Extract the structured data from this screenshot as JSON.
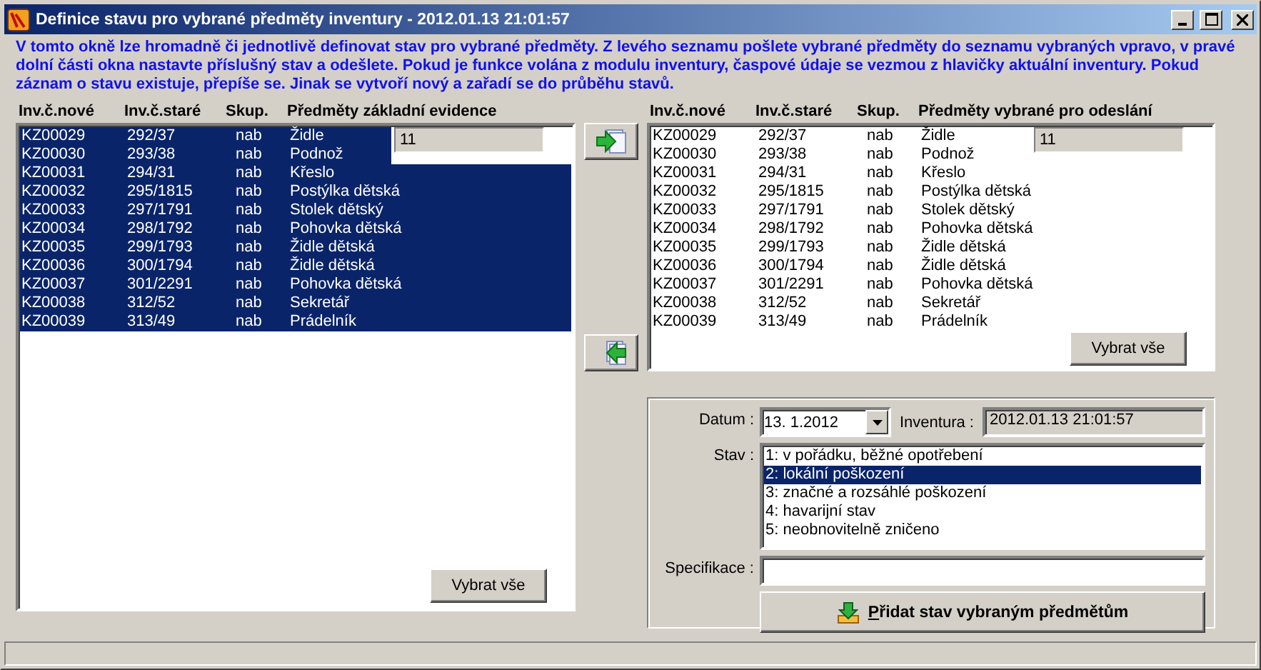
{
  "window": {
    "title": "Definice stavu pro vybrané předměty inventury - 2012.01.13 21:01:57"
  },
  "info": "V tomto okně lze hromadně či jednotlivě definovat stav pro vybrané předměty. Z levého seznamu pošlete vybrané předměty do seznamu vybraných vpravo, v pravé dolní části okna  nastavte příslušný stav a odešlete. Pokud  je funkce volána z modulu inventury, časpové údaje se vezmou z hlavičky aktuální inventury. Pokud záznam o stavu existuje, přepíše se. Jinak se vytvoří nový a zařadí se do průběhu stavů.",
  "left_list": {
    "columns": [
      "Inv.č.nové",
      "Inv.č.staré",
      "Skup.",
      "Předměty základní evidence"
    ],
    "count": "11",
    "button": "Vybrat vše",
    "rows": [
      {
        "cells": [
          "KZ00029",
          "292/37",
          "nab",
          "Židle"
        ],
        "selected": true
      },
      {
        "cells": [
          "KZ00030",
          "293/38",
          "nab",
          "Podnož"
        ],
        "selected": true
      },
      {
        "cells": [
          "KZ00031",
          "294/31",
          "nab",
          "Křeslo"
        ],
        "selected": true
      },
      {
        "cells": [
          "KZ00032",
          "295/1815",
          "nab",
          "Postýlka dětská"
        ],
        "selected": true
      },
      {
        "cells": [
          "KZ00033",
          "297/1791",
          "nab",
          "Stolek dětský"
        ],
        "selected": true
      },
      {
        "cells": [
          "KZ00034",
          "298/1792",
          "nab",
          "Pohovka dětská"
        ],
        "selected": true
      },
      {
        "cells": [
          "KZ00035",
          "299/1793",
          "nab",
          "Židle dětská"
        ],
        "selected": true
      },
      {
        "cells": [
          "KZ00036",
          "300/1794",
          "nab",
          "Židle dětská"
        ],
        "selected": true
      },
      {
        "cells": [
          "KZ00037",
          "301/2291",
          "nab",
          "Pohovka dětská"
        ],
        "selected": true
      },
      {
        "cells": [
          "KZ00038",
          "312/52",
          "nab",
          "Sekretář"
        ],
        "selected": true
      },
      {
        "cells": [
          "KZ00039",
          "313/49",
          "nab",
          "Prádelník"
        ],
        "selected": true
      }
    ]
  },
  "right_list": {
    "columns": [
      "Inv.č.nové",
      "Inv.č.staré",
      "Skup.",
      "Předměty vybrané pro odeslání"
    ],
    "count": "11",
    "button": "Vybrat vše",
    "rows": [
      {
        "cells": [
          "KZ00029",
          "292/37",
          "nab",
          "Židle"
        ],
        "selected": false
      },
      {
        "cells": [
          "KZ00030",
          "293/38",
          "nab",
          "Podnož"
        ],
        "selected": false
      },
      {
        "cells": [
          "KZ00031",
          "294/31",
          "nab",
          "Křeslo"
        ],
        "selected": false
      },
      {
        "cells": [
          "KZ00032",
          "295/1815",
          "nab",
          "Postýlka dětská"
        ],
        "selected": false
      },
      {
        "cells": [
          "KZ00033",
          "297/1791",
          "nab",
          "Stolek dětský"
        ],
        "selected": false
      },
      {
        "cells": [
          "KZ00034",
          "298/1792",
          "nab",
          "Pohovka dětská"
        ],
        "selected": false
      },
      {
        "cells": [
          "KZ00035",
          "299/1793",
          "nab",
          "Židle dětská"
        ],
        "selected": false
      },
      {
        "cells": [
          "KZ00036",
          "300/1794",
          "nab",
          "Židle dětská"
        ],
        "selected": false
      },
      {
        "cells": [
          "KZ00037",
          "301/2291",
          "nab",
          "Pohovka dětská"
        ],
        "selected": false
      },
      {
        "cells": [
          "KZ00038",
          "312/52",
          "nab",
          "Sekretář"
        ],
        "selected": false
      },
      {
        "cells": [
          "KZ00039",
          "313/49",
          "nab",
          "Prádelník"
        ],
        "selected": false
      }
    ]
  },
  "form": {
    "date_label": "Datum :",
    "date": "13.  1.2012",
    "inventory_label": "Inventura :",
    "inventory": "2012.01.13 21:01:57",
    "state_label": "Stav :",
    "states": [
      {
        "label": "1: v pořádku, běžné opotřebení",
        "selected": false
      },
      {
        "label": "2: lokální poškození",
        "selected": true
      },
      {
        "label": "3: značné a rozsáhlé poškození",
        "selected": false
      },
      {
        "label": "4: havarijní stav",
        "selected": false
      },
      {
        "label": "5: neobnovitelně zničeno",
        "selected": false
      }
    ],
    "spec_label": "Specifikace :",
    "submit": {
      "label": "Přidat stav vybraným předmětům"
    }
  }
}
